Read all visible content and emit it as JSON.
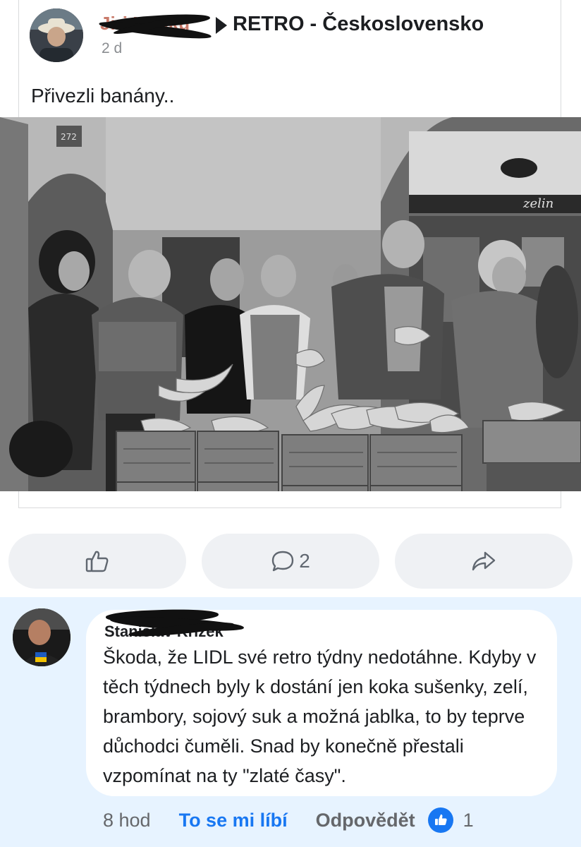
{
  "post": {
    "author": "Jiri Honku",
    "group": "RETRO - Československo",
    "time": "2 d",
    "text": "Přivezli banány..",
    "photo": {
      "sign_number": "272",
      "shop_sign": "zelin"
    }
  },
  "actions": {
    "like_icon": "thumbs-up-icon",
    "comment_icon": "comment-icon",
    "comment_count": "2",
    "share_icon": "share-arrow-icon"
  },
  "comment": {
    "author": "Stanislav Křížek",
    "text": "Škoda, že LIDL své retro týdny nedotáhne. Kdyby v těch týdnech byly k dostání jen koka sušenky, zelí, brambory, sojový suk a možná jablka, to by teprve důchodci čuměli. Snad by konečně přestali vzpomínat na ty \"zlaté časy\".",
    "time": "8 hod",
    "like_label": "To se mi líbí",
    "reply_label": "Odpovědět",
    "reaction_icon": "like-reaction-icon",
    "reaction_count": "1"
  },
  "colors": {
    "accent": "#1877f2",
    "comment_bg": "#e7f3ff",
    "button_bg": "#eff1f4"
  }
}
